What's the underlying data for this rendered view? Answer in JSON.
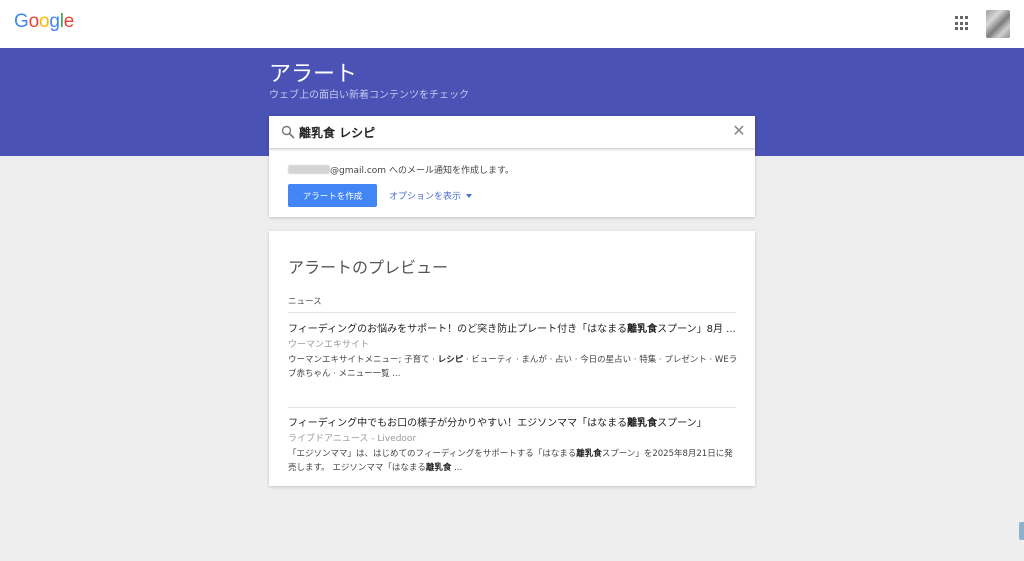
{
  "header": {
    "logo_letters": [
      {
        "ch": "G",
        "color": "#4285F4"
      },
      {
        "ch": "o",
        "color": "#EA4335"
      },
      {
        "ch": "o",
        "color": "#FBBC05"
      },
      {
        "ch": "g",
        "color": "#4285F4"
      },
      {
        "ch": "l",
        "color": "#34A853"
      },
      {
        "ch": "e",
        "color": "#EA4335"
      }
    ],
    "apps_icon": "apps-grid-icon",
    "avatar_icon": "user-avatar"
  },
  "banner": {
    "title": "アラート",
    "subtitle": "ウェブ上の面白い新着コンテンツをチェック",
    "color": "#4A52B5"
  },
  "search": {
    "value": "離乳食 レシピ",
    "search_icon": "search-icon",
    "clear_icon": "close-icon",
    "clear_glyph": "✕"
  },
  "create_card": {
    "email_suffix": "@gmail.com へのメール通知を作成します。",
    "create_button": "アラートを作成",
    "options_link": "オプションを表示",
    "button_color": "#4285F4"
  },
  "preview": {
    "title": "アラートのプレビュー",
    "section_label": "ニュース",
    "items": [
      {
        "title_parts": [
          {
            "text": "フィーディングのお悩みをサポート！のど突き防止プレート付き「はなまる",
            "bold": false
          },
          {
            "text": "離乳食",
            "bold": true
          },
          {
            "text": "スプーン」8月 ...",
            "bold": false
          }
        ],
        "source": "ウーマンエキサイト",
        "snippet_parts": [
          {
            "text": "ウーマンエキサイトメニュー; 子育て · ",
            "bold": false
          },
          {
            "text": "レシピ",
            "bold": true
          },
          {
            "text": " · ビューティ · まんが · 占い · 今日の星占い · 特集 · プレゼント · WEラブ赤ちゃん · メニュー一覧 ...",
            "bold": false
          }
        ]
      },
      {
        "title_parts": [
          {
            "text": "フィーディング中でもお口の様子が分かりやすい！エジソンママ「はなまる",
            "bold": false
          },
          {
            "text": "離乳食",
            "bold": true
          },
          {
            "text": "スプーン」",
            "bold": false
          }
        ],
        "source": "ライブドアニュース - Livedoor",
        "snippet_parts": [
          {
            "text": "「エジソンママ」は、はじめてのフィーディングをサポートする「はなまる",
            "bold": false
          },
          {
            "text": "離乳食",
            "bold": true
          },
          {
            "text": "スプーン」を2025年8月21日に発売します。 エジソンママ「はなまる",
            "bold": false
          },
          {
            "text": "離乳食",
            "bold": true
          },
          {
            "text": " ...",
            "bold": false
          }
        ]
      }
    ]
  }
}
